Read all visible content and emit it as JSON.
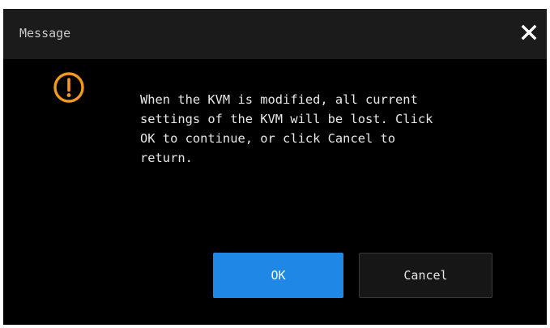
{
  "dialog": {
    "title": "Message",
    "close_icon": "close-icon",
    "warning_icon": "warning-circle-icon",
    "message": "When the KVM is modified, all current\nsettings of the KVM will be lost. Click\nOK to continue, or click Cancel to\nreturn.",
    "ok_label": "OK",
    "cancel_label": "Cancel"
  },
  "colors": {
    "background": "#000000",
    "titlebar": "#1b1b1b",
    "accent_ok": "#1f87e6",
    "warning": "#f39a1e",
    "text": "#e8e8e8"
  }
}
